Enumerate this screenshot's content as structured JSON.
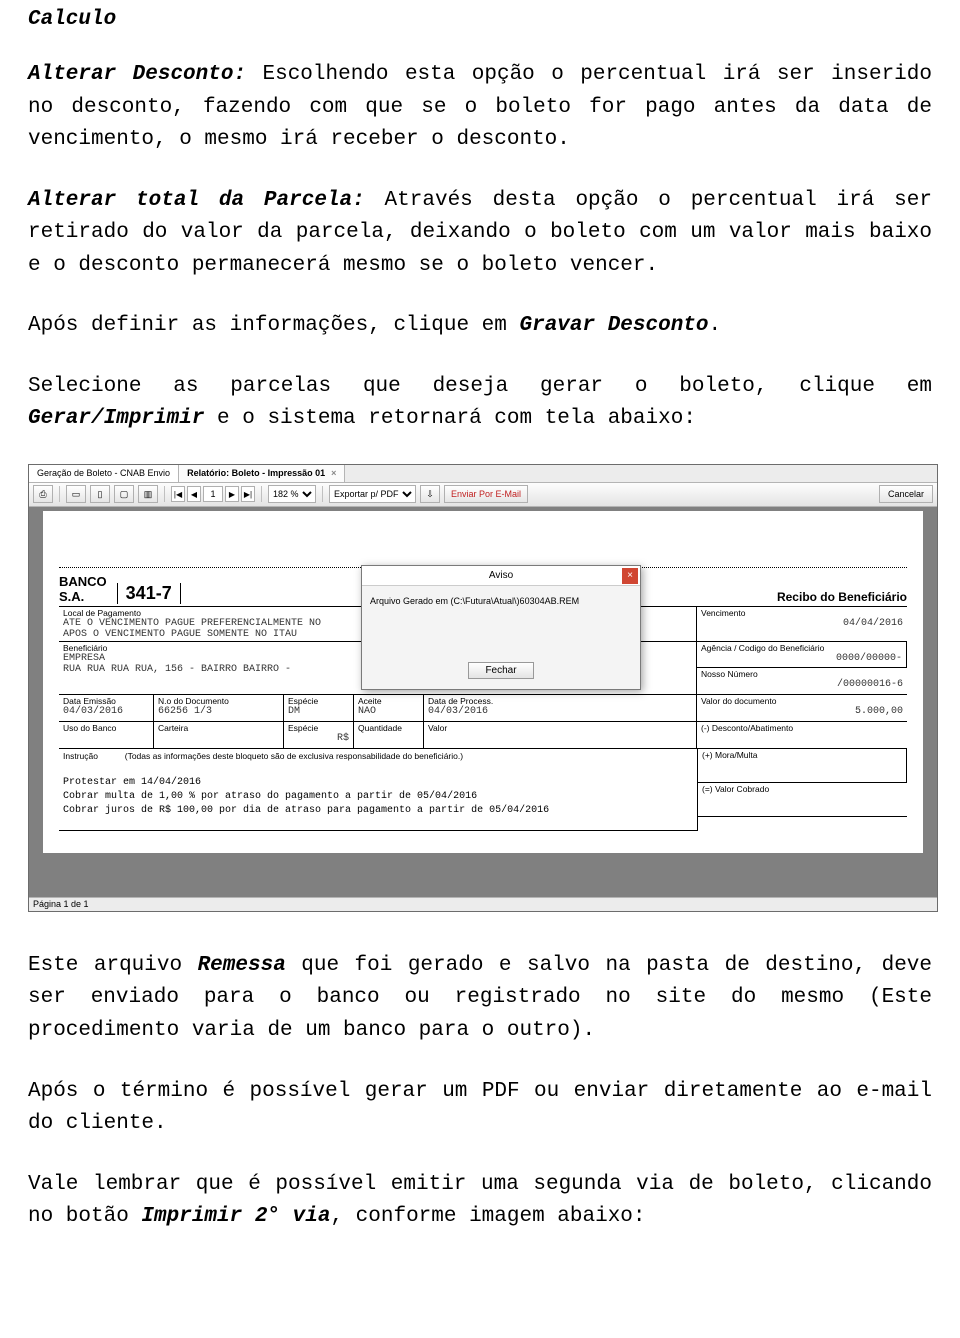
{
  "doc": {
    "heading": "Calculo",
    "p1a": "Alterar Desconto:",
    "p1b": " Escolhendo esta opção o percentual irá ser inserido no desconto, fazendo com que se o boleto for pago antes da data de vencimento, o mesmo irá receber o desconto.",
    "p2a": "Alterar total da Parcela:",
    "p2b": " Através desta opção o percentual irá ser retirado do valor da parcela, deixando o boleto com um valor mais baixo e o desconto permanecerá mesmo se o boleto vencer.",
    "p3a": "Após definir as informações, clique em ",
    "p3b": "Gravar Desconto",
    "p3c": ".",
    "p4a": "Selecione as parcelas que deseja gerar o boleto, clique em ",
    "p4b": "Gerar/Imprimir",
    "p4c": " e o sistema retornará com tela abaixo:",
    "p5a": "Este arquivo ",
    "p5b": "Remessa",
    "p5c": " que foi gerado e salvo na pasta de destino, deve ser enviado para o banco ou registrado no site do mesmo (Este procedimento varia de um banco para o outro).",
    "p6": "Após o término é possível gerar um PDF ou enviar diretamente ao e-mail do cliente.",
    "p7a": "Vale lembrar que é possível emitir uma segunda via de boleto, clicando no botão ",
    "p7b": "Imprimir 2° via",
    "p7c": ", conforme imagem abaixo:"
  },
  "shot": {
    "tabs": {
      "t1": "Geração de Boleto - CNAB Envio",
      "t2": "Relatório: Boleto - Impressão 01"
    },
    "toolbar": {
      "page": "1",
      "zoom": "182 %",
      "export": "Exportar p/ PDF",
      "email": "Enviar Por E-Mail",
      "cancel": "Cancelar"
    },
    "modal": {
      "title": "Aviso",
      "msg": "Arquivo Gerado em (C:\\Futura\\Atual\\)60304AB.REM",
      "ok": "Fechar"
    },
    "boleto": {
      "banco_line1": "BANCO",
      "banco_line2": "S.A.",
      "bankcode": "341-7",
      "recibo": "Recibo do Beneficiário",
      "local_pag_lbl": "Local de Pagamento",
      "local_pag_l1": "ATE O VENCIMENTO PAGUE PREFERENCIALMENTE NO",
      "local_pag_l2": "APOS O VENCIMENTO PAGUE SOMENTE NO ITAU",
      "benef_lbl": "Beneficiário",
      "benef_l1": "EMPRESA",
      "benef_l2": "RUA RUA RUA RUA, 156 - BAIRRO BAIRRO -",
      "venc_lbl": "Vencimento",
      "venc_val": "04/04/2016",
      "ag_lbl": "Agência / Codigo do Beneficiário",
      "ag_val": "0000/00000-",
      "nosso_lbl": "Nosso Número",
      "nosso_val": "/00000016-6",
      "emissao_lbl": "Data Emissão",
      "emissao_val": "04/03/2016",
      "ndoc_lbl": "N.o do Documento",
      "ndoc_val": "66256 1/3",
      "esp_lbl": "Espécie",
      "esp_val": "DM",
      "aceite_lbl": "Aceite",
      "aceite_val": "NAO",
      "proc_lbl": "Data de Process.",
      "proc_val": "04/03/2016",
      "valor_lbl": "Valor do documento",
      "valor_val": "5.000,00",
      "uso_lbl": "Uso do Banco",
      "carteira_lbl": "Carteira",
      "especie_lbl": "Espécie",
      "especie_val": "R$",
      "qtd_lbl": "Quantidade",
      "valor2_lbl": "Valor",
      "desc_lbl": "(-) Desconto/Abatimento",
      "mora_lbl": "(+) Mora/Multa",
      "valcob_lbl": "(=) Valor Cobrado",
      "instr_lbl": "Instrução",
      "instr_sub": "(Todas as informações deste bloqueto são de exclusiva responsabilidade do beneficiário.)",
      "instr1": "Protestar em 14/04/2016",
      "instr2": "Cobrar multa de 1,00 % por atraso do pagamento a partir de 05/04/2016",
      "instr3": "Cobrar juros de R$ 100,00 por dia de atraso para pagamento a partir de 05/04/2016"
    },
    "status": "Página 1 de 1"
  }
}
